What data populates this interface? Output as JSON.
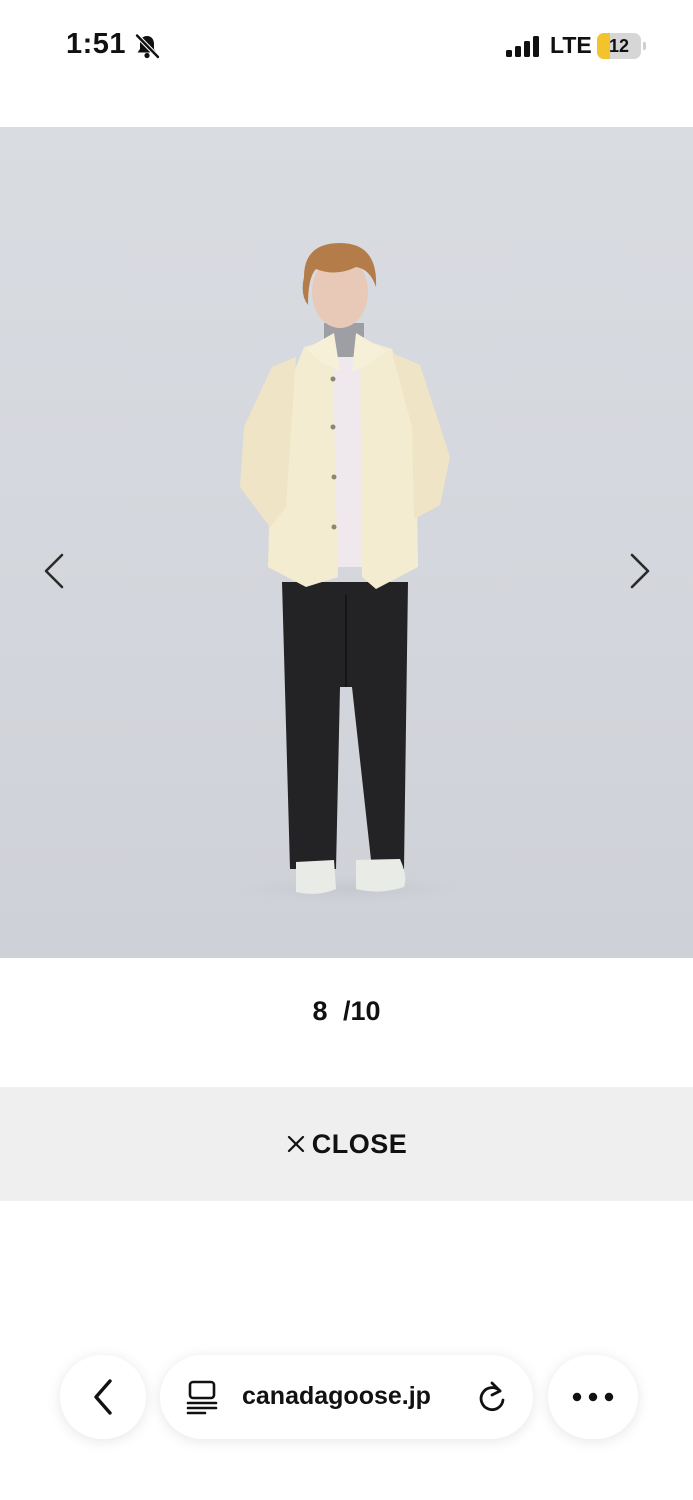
{
  "status_bar": {
    "time": "1:51",
    "network": "LTE",
    "battery_level": "12",
    "battery_fraction": 0.12,
    "icons": [
      "bell-slash-icon",
      "signal-icon"
    ]
  },
  "gallery": {
    "counter_current": "8",
    "counter_total": "/10",
    "image_alt": "",
    "icons": [
      "chevron-left-icon",
      "chevron-right-icon"
    ]
  },
  "close": {
    "label": "CLOSE",
    "icon": "close-icon"
  },
  "browser": {
    "url": "canadagoose.jp",
    "icons": [
      "chevron-left-icon",
      "reader-icon",
      "reload-icon",
      "more-icon"
    ]
  },
  "colors": {
    "background": "#ffffff",
    "close_bar": "#efefef",
    "battery_accent": "#f3c32b",
    "photo_backdrop": "#d6d9de"
  }
}
